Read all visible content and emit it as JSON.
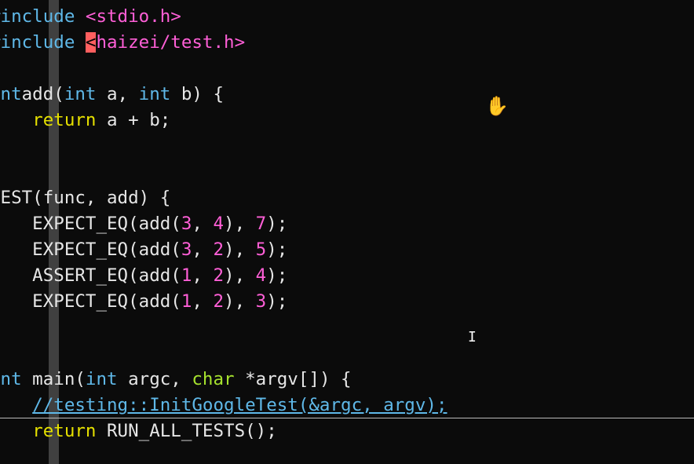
{
  "editor": {
    "lines": [
      {
        "id": "l1",
        "parts": [
          [
            "kw",
            "#include "
          ],
          [
            "str",
            "<stdio.h>"
          ]
        ]
      },
      {
        "id": "l2",
        "parts": [
          [
            "kw",
            "#include "
          ],
          [
            "cursor",
            "<"
          ],
          [
            "str",
            "haizei/test.h>"
          ]
        ]
      },
      {
        "id": "l3",
        "parts": []
      },
      {
        "id": "l4",
        "parts": [
          [
            "kw",
            "int"
          ],
          [
            "",
            "add("
          ],
          [
            "kw",
            "int"
          ],
          [
            "",
            " a, "
          ],
          [
            "kw",
            "int"
          ],
          [
            "",
            " b) {"
          ]
        ]
      },
      {
        "id": "l5",
        "parts": [
          [
            "",
            "    "
          ],
          [
            "yel",
            "return"
          ],
          [
            "",
            " a + b;"
          ]
        ]
      },
      {
        "id": "l6",
        "parts": [
          [
            "tilde",
            "}"
          ]
        ]
      },
      {
        "id": "l7",
        "parts": []
      },
      {
        "id": "l8",
        "parts": [
          [
            "",
            "TEST(func, add) {"
          ]
        ]
      },
      {
        "id": "l9",
        "parts": [
          [
            "",
            "    EXPECT_EQ(add("
          ],
          [
            "num",
            "3"
          ],
          [
            "",
            ", "
          ],
          [
            "num",
            "4"
          ],
          [
            "",
            "), "
          ],
          [
            "num",
            "7"
          ],
          [
            "",
            ");"
          ]
        ]
      },
      {
        "id": "l10",
        "parts": [
          [
            "",
            "    EXPECT_EQ(add("
          ],
          [
            "num",
            "3"
          ],
          [
            "",
            ", "
          ],
          [
            "num",
            "2"
          ],
          [
            "",
            "), "
          ],
          [
            "num",
            "5"
          ],
          [
            "",
            ");"
          ]
        ]
      },
      {
        "id": "l11",
        "parts": [
          [
            "",
            "    ASSERT_EQ(add("
          ],
          [
            "num",
            "1"
          ],
          [
            "",
            ", "
          ],
          [
            "num",
            "2"
          ],
          [
            "",
            "), "
          ],
          [
            "num",
            "4"
          ],
          [
            "",
            ");"
          ]
        ]
      },
      {
        "id": "l12",
        "parts": [
          [
            "",
            "    EXPECT_EQ(add("
          ],
          [
            "num",
            "1"
          ],
          [
            "",
            ", "
          ],
          [
            "num",
            "2"
          ],
          [
            "",
            "), "
          ],
          [
            "num",
            "3"
          ],
          [
            "",
            ");"
          ]
        ]
      },
      {
        "id": "l13",
        "parts": [
          [
            "tilde",
            "}"
          ]
        ]
      },
      {
        "id": "l14",
        "parts": []
      },
      {
        "id": "l15",
        "parts": [
          [
            "kw",
            "int"
          ],
          [
            "",
            " main("
          ],
          [
            "kw",
            "int"
          ],
          [
            "",
            " argc, "
          ],
          [
            "grn",
            "char"
          ],
          [
            "",
            " *argv[]) {"
          ]
        ]
      },
      {
        "id": "l16",
        "parts": [
          [
            "",
            "    "
          ],
          [
            "cmt under",
            "//testing::InitGoogleTest(&argc, argv);"
          ]
        ]
      },
      {
        "id": "l17",
        "parts": [
          [
            "",
            "    "
          ],
          [
            "yel",
            "return"
          ],
          [
            "",
            " RUN_ALL_TESTS();"
          ]
        ]
      }
    ]
  },
  "cursors": {
    "hand": "hand-pointer-icon",
    "ibeam": "text-cursor-icon"
  }
}
